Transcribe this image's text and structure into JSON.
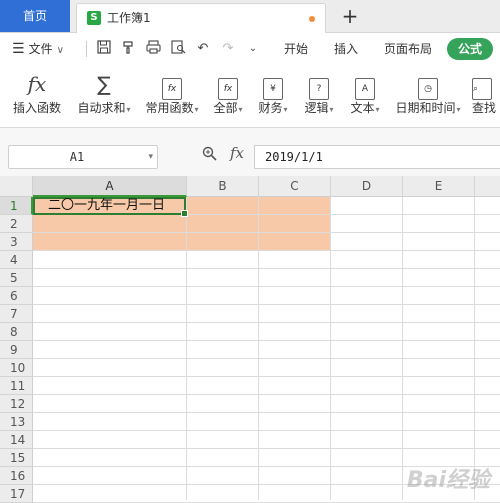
{
  "tabs": {
    "home_label": "首页",
    "doc_icon": "S",
    "doc_title": "工作簿1",
    "add_label": "+"
  },
  "menu": {
    "file_label": "文件",
    "items": [
      "开始",
      "插入",
      "页面布局"
    ],
    "active_label": "公式"
  },
  "ribbon": {
    "buttons": [
      {
        "label": "插入函数",
        "icon": "fx-icon",
        "dropdown": false
      },
      {
        "label": "自动求和",
        "icon": "sigma-icon",
        "dropdown": true
      },
      {
        "label": "常用函数",
        "icon": "common-functions-icon",
        "dropdown": true
      },
      {
        "label": "全部",
        "icon": "all-functions-icon",
        "dropdown": true
      },
      {
        "label": "财务",
        "icon": "finance-icon",
        "dropdown": true
      },
      {
        "label": "逻辑",
        "icon": "logic-icon",
        "dropdown": true
      },
      {
        "label": "文本",
        "icon": "text-icon",
        "dropdown": true
      },
      {
        "label": "日期和时间",
        "icon": "datetime-icon",
        "dropdown": true
      },
      {
        "label": "查找",
        "icon": "lookup-icon",
        "dropdown": false
      }
    ]
  },
  "formula_bar": {
    "name_box": "A1",
    "fx_label": "fx",
    "value": "2019/1/1"
  },
  "sheet": {
    "columns": [
      "A",
      "B",
      "C",
      "D",
      "E"
    ],
    "rows": [
      "1",
      "2",
      "3",
      "4",
      "5",
      "6",
      "7",
      "8",
      "9",
      "10",
      "11",
      "12",
      "13",
      "14",
      "15",
      "16",
      "17"
    ],
    "selected_cell": "A1",
    "cell_a1_display": "二〇一九年一月一日",
    "fill_color": "#f8c9a8",
    "selection_color": "#2e7d32"
  },
  "watermark": "Bai经验"
}
